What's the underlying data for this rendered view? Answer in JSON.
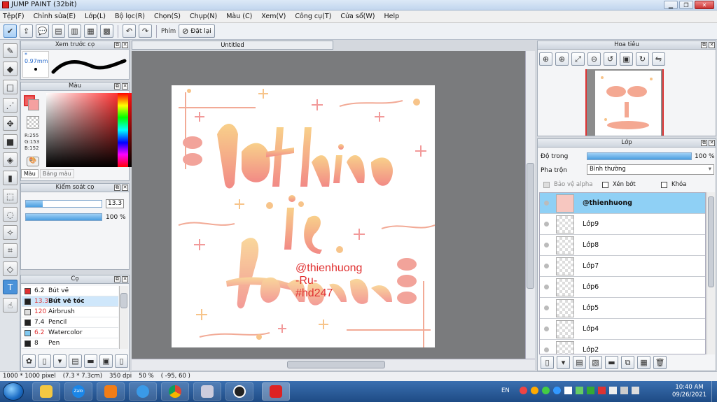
{
  "window": {
    "title": "JUMP PAINT (32bit)"
  },
  "menu": [
    "Tệp(F)",
    "Chỉnh sửa(E)",
    "Lớp(L)",
    "Bộ lọc(R)",
    "Chọn(S)",
    "Chụp(N)",
    "Màu (C)",
    "Xem(V)",
    "Công cụ(T)",
    "Cửa sổ(W)",
    "Help"
  ],
  "toolbar": {
    "phim_label": "Phím",
    "dat_lai_label": "Đặt lại"
  },
  "preview": {
    "title": "Xem trước cọ",
    "size": "* 0.97mm"
  },
  "color": {
    "title": "Màu",
    "r": "R:255",
    "g": "G:153",
    "b": "B:152",
    "tab_mau": "Màu",
    "tab_bang": "Bảng màu",
    "fg": "#f06060"
  },
  "brush_control": {
    "title": "Kiểm soát cọ",
    "size_value": "13.3",
    "size_fraction": 0.22,
    "opacity_value": "100 %",
    "opacity_fraction": 1.0
  },
  "brushes": {
    "title": "Cọ",
    "items": [
      {
        "num": "6.2",
        "name": "Bút vẽ",
        "color": "#e03030",
        "selected": false
      },
      {
        "num": "13.3",
        "name": "Bút vẽ tóc",
        "color": "#222222",
        "selected": true
      },
      {
        "num": "120",
        "name": "Airbrush",
        "color": "#dddddd",
        "selected": false
      },
      {
        "num": "7.4",
        "name": "Pencil",
        "color": "#222222",
        "selected": false
      },
      {
        "num": "6.2",
        "name": "Watercolor",
        "color": "#80c8f0",
        "selected": false
      },
      {
        "num": "8",
        "name": "Pen",
        "color": "#222222",
        "selected": false
      }
    ]
  },
  "document": {
    "tab": "Untitled"
  },
  "artwork": {
    "watermark_1": "@thienhuong",
    "watermark_2": "-Ru-",
    "watermark_3": "#hd247",
    "art_alt": "Nothing is forever"
  },
  "navigator": {
    "title": "Hoa tiêu"
  },
  "layers": {
    "title": "Lớp",
    "opacity_label": "Độ trong",
    "opacity_value": "100 %",
    "opacity_fraction": 1.0,
    "blend_label": "Pha trộn",
    "blend_value": "Bình thường",
    "alpha_label": "Bảo vệ alpha",
    "clip_label": "Xén bớt",
    "lock_label": "Khóa",
    "items": [
      {
        "name": "@thienhuong",
        "selected": true
      },
      {
        "name": "Lớp9",
        "selected": false
      },
      {
        "name": "Lớp8",
        "selected": false
      },
      {
        "name": "Lớp7",
        "selected": false
      },
      {
        "name": "Lớp6",
        "selected": false
      },
      {
        "name": "Lớp5",
        "selected": false
      },
      {
        "name": "Lớp4",
        "selected": false
      },
      {
        "name": "Lớp2",
        "selected": false
      }
    ]
  },
  "status": {
    "pixels": "1000 * 1000 pixel",
    "cm": "(7.3 * 7.3cm)",
    "dpi": "350 dpi",
    "zoom": "50 %",
    "coords": "( -95, 60 )"
  },
  "taskbar": {
    "lang": "EN",
    "time": "10:40 AM",
    "date": "09/26/2021",
    "zalo": "Zalo"
  }
}
